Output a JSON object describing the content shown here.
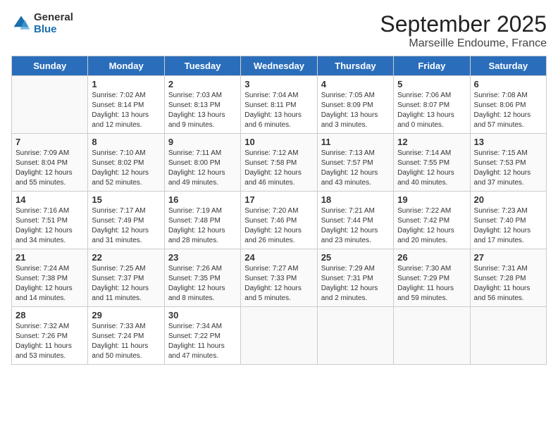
{
  "header": {
    "logo_general": "General",
    "logo_blue": "Blue",
    "month": "September 2025",
    "location": "Marseille Endoume, France"
  },
  "weekdays": [
    "Sunday",
    "Monday",
    "Tuesday",
    "Wednesday",
    "Thursday",
    "Friday",
    "Saturday"
  ],
  "weeks": [
    [
      {
        "num": "",
        "info": ""
      },
      {
        "num": "1",
        "info": "Sunrise: 7:02 AM\nSunset: 8:14 PM\nDaylight: 13 hours\nand 12 minutes."
      },
      {
        "num": "2",
        "info": "Sunrise: 7:03 AM\nSunset: 8:13 PM\nDaylight: 13 hours\nand 9 minutes."
      },
      {
        "num": "3",
        "info": "Sunrise: 7:04 AM\nSunset: 8:11 PM\nDaylight: 13 hours\nand 6 minutes."
      },
      {
        "num": "4",
        "info": "Sunrise: 7:05 AM\nSunset: 8:09 PM\nDaylight: 13 hours\nand 3 minutes."
      },
      {
        "num": "5",
        "info": "Sunrise: 7:06 AM\nSunset: 8:07 PM\nDaylight: 13 hours\nand 0 minutes."
      },
      {
        "num": "6",
        "info": "Sunrise: 7:08 AM\nSunset: 8:06 PM\nDaylight: 12 hours\nand 57 minutes."
      }
    ],
    [
      {
        "num": "7",
        "info": "Sunrise: 7:09 AM\nSunset: 8:04 PM\nDaylight: 12 hours\nand 55 minutes."
      },
      {
        "num": "8",
        "info": "Sunrise: 7:10 AM\nSunset: 8:02 PM\nDaylight: 12 hours\nand 52 minutes."
      },
      {
        "num": "9",
        "info": "Sunrise: 7:11 AM\nSunset: 8:00 PM\nDaylight: 12 hours\nand 49 minutes."
      },
      {
        "num": "10",
        "info": "Sunrise: 7:12 AM\nSunset: 7:58 PM\nDaylight: 12 hours\nand 46 minutes."
      },
      {
        "num": "11",
        "info": "Sunrise: 7:13 AM\nSunset: 7:57 PM\nDaylight: 12 hours\nand 43 minutes."
      },
      {
        "num": "12",
        "info": "Sunrise: 7:14 AM\nSunset: 7:55 PM\nDaylight: 12 hours\nand 40 minutes."
      },
      {
        "num": "13",
        "info": "Sunrise: 7:15 AM\nSunset: 7:53 PM\nDaylight: 12 hours\nand 37 minutes."
      }
    ],
    [
      {
        "num": "14",
        "info": "Sunrise: 7:16 AM\nSunset: 7:51 PM\nDaylight: 12 hours\nand 34 minutes."
      },
      {
        "num": "15",
        "info": "Sunrise: 7:17 AM\nSunset: 7:49 PM\nDaylight: 12 hours\nand 31 minutes."
      },
      {
        "num": "16",
        "info": "Sunrise: 7:19 AM\nSunset: 7:48 PM\nDaylight: 12 hours\nand 28 minutes."
      },
      {
        "num": "17",
        "info": "Sunrise: 7:20 AM\nSunset: 7:46 PM\nDaylight: 12 hours\nand 26 minutes."
      },
      {
        "num": "18",
        "info": "Sunrise: 7:21 AM\nSunset: 7:44 PM\nDaylight: 12 hours\nand 23 minutes."
      },
      {
        "num": "19",
        "info": "Sunrise: 7:22 AM\nSunset: 7:42 PM\nDaylight: 12 hours\nand 20 minutes."
      },
      {
        "num": "20",
        "info": "Sunrise: 7:23 AM\nSunset: 7:40 PM\nDaylight: 12 hours\nand 17 minutes."
      }
    ],
    [
      {
        "num": "21",
        "info": "Sunrise: 7:24 AM\nSunset: 7:38 PM\nDaylight: 12 hours\nand 14 minutes."
      },
      {
        "num": "22",
        "info": "Sunrise: 7:25 AM\nSunset: 7:37 PM\nDaylight: 12 hours\nand 11 minutes."
      },
      {
        "num": "23",
        "info": "Sunrise: 7:26 AM\nSunset: 7:35 PM\nDaylight: 12 hours\nand 8 minutes."
      },
      {
        "num": "24",
        "info": "Sunrise: 7:27 AM\nSunset: 7:33 PM\nDaylight: 12 hours\nand 5 minutes."
      },
      {
        "num": "25",
        "info": "Sunrise: 7:29 AM\nSunset: 7:31 PM\nDaylight: 12 hours\nand 2 minutes."
      },
      {
        "num": "26",
        "info": "Sunrise: 7:30 AM\nSunset: 7:29 PM\nDaylight: 11 hours\nand 59 minutes."
      },
      {
        "num": "27",
        "info": "Sunrise: 7:31 AM\nSunset: 7:28 PM\nDaylight: 11 hours\nand 56 minutes."
      }
    ],
    [
      {
        "num": "28",
        "info": "Sunrise: 7:32 AM\nSunset: 7:26 PM\nDaylight: 11 hours\nand 53 minutes."
      },
      {
        "num": "29",
        "info": "Sunrise: 7:33 AM\nSunset: 7:24 PM\nDaylight: 11 hours\nand 50 minutes."
      },
      {
        "num": "30",
        "info": "Sunrise: 7:34 AM\nSunset: 7:22 PM\nDaylight: 11 hours\nand 47 minutes."
      },
      {
        "num": "",
        "info": ""
      },
      {
        "num": "",
        "info": ""
      },
      {
        "num": "",
        "info": ""
      },
      {
        "num": "",
        "info": ""
      }
    ]
  ]
}
